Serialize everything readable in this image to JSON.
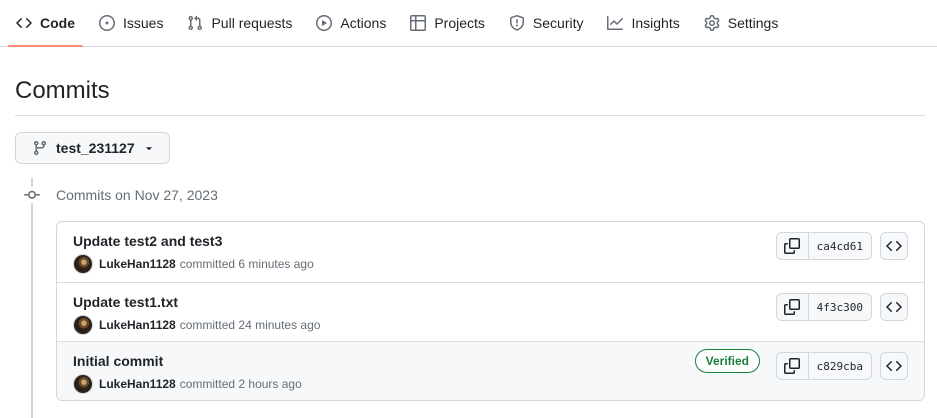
{
  "nav": {
    "items": [
      {
        "label": "Code",
        "icon": "code-icon",
        "selected": true
      },
      {
        "label": "Issues",
        "icon": "issue-opened-icon"
      },
      {
        "label": "Pull requests",
        "icon": "git-pull-request-icon"
      },
      {
        "label": "Actions",
        "icon": "play-icon"
      },
      {
        "label": "Projects",
        "icon": "table-icon"
      },
      {
        "label": "Security",
        "icon": "shield-icon"
      },
      {
        "label": "Insights",
        "icon": "graph-icon"
      },
      {
        "label": "Settings",
        "icon": "gear-icon"
      }
    ],
    "accent_color": "#fd8c73"
  },
  "page": {
    "title": "Commits"
  },
  "branch": {
    "name": "test_231127",
    "icon": "git-branch-icon"
  },
  "timeline": {
    "date_label": "Commits on Nov 27, 2023"
  },
  "commits": [
    {
      "title": "Update test2 and test3",
      "author": "LukeHan1128",
      "time_text": "committed 6 minutes ago",
      "sha": "ca4cd61",
      "verified": ""
    },
    {
      "title": "Update test1.txt",
      "author": "LukeHan1128",
      "time_text": "committed 24 minutes ago",
      "sha": "4f3c300",
      "verified": ""
    },
    {
      "title": "Initial commit",
      "author": "LukeHan1128",
      "time_text": "committed 2 hours ago",
      "sha": "c829cba",
      "verified": "Verified"
    }
  ],
  "colors": {
    "verified": "#1a7f37",
    "border": "#d0d7de",
    "muted_text": "#656d76"
  }
}
